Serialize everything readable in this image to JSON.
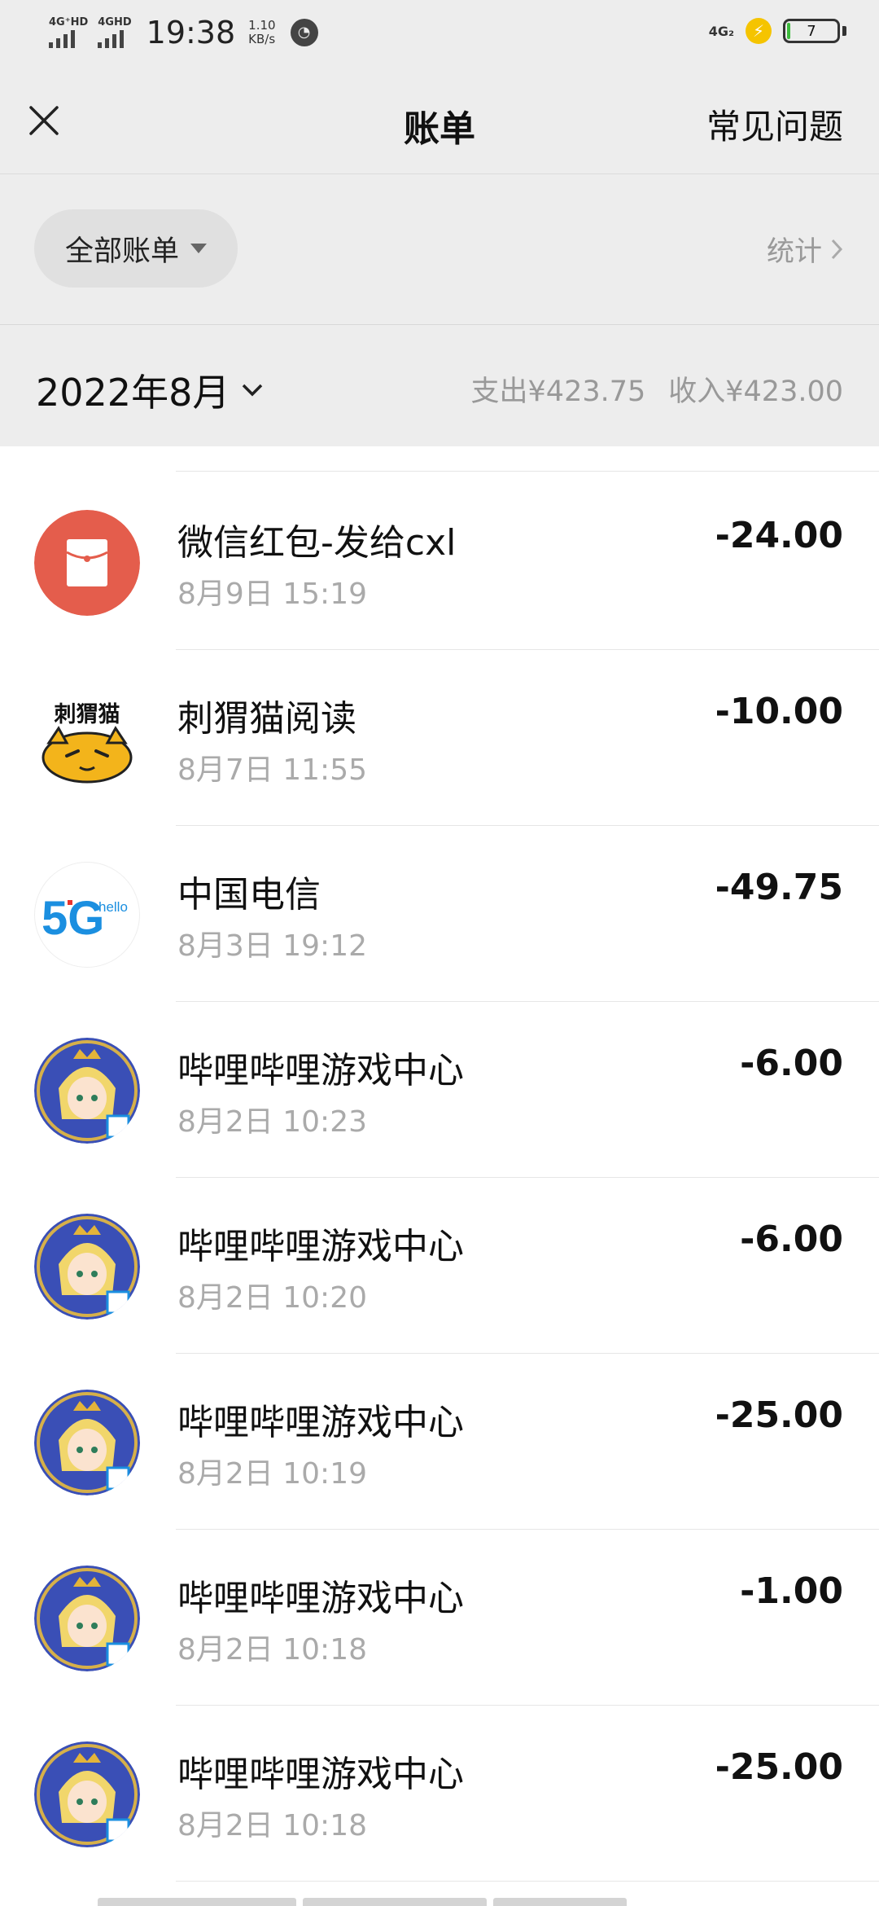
{
  "status_bar": {
    "signal1": "4G⁺HD",
    "signal2": "4GHD",
    "time": "19:38",
    "speed_value": "1.10",
    "speed_unit": "KB/s",
    "network": "4G₂",
    "battery_level": "7",
    "battery_fraction": 0.07
  },
  "nav": {
    "close_icon": "close-icon",
    "title": "账单",
    "faq_label": "常见问题"
  },
  "filter": {
    "label": "全部账单",
    "stats_label": "统计"
  },
  "month": {
    "label": "2022年8月",
    "expense": "支出¥423.75",
    "income": "收入¥423.00"
  },
  "transactions": [
    {
      "merchant": "微信红包-发给cxl",
      "time": "8月9日 15:19",
      "amount": "-24.00",
      "icon": "red-packet-icon"
    },
    {
      "merchant": "刺猬猫阅读",
      "time": "8月7日 11:55",
      "amount": "-10.00",
      "icon": "ciweimao-logo"
    },
    {
      "merchant": "中国电信",
      "time": "8月3日 19:12",
      "amount": "-49.75",
      "icon": "5g-hello-logo"
    },
    {
      "merchant": "哔哩哔哩游戏中心",
      "time": "8月2日 10:23",
      "amount": "-6.00",
      "icon": "game-avatar"
    },
    {
      "merchant": "哔哩哔哩游戏中心",
      "time": "8月2日 10:20",
      "amount": "-6.00",
      "icon": "game-avatar"
    },
    {
      "merchant": "哔哩哔哩游戏中心",
      "time": "8月2日 10:19",
      "amount": "-25.00",
      "icon": "game-avatar"
    },
    {
      "merchant": "哔哩哔哩游戏中心",
      "time": "8月2日 10:18",
      "amount": "-1.00",
      "icon": "game-avatar"
    },
    {
      "merchant": "哔哩哔哩游戏中心",
      "time": "8月2日 10:18",
      "amount": "-25.00",
      "icon": "game-avatar"
    }
  ],
  "logos": {
    "ciweimao_text": "刺猬猫",
    "telecom_5g": "5G",
    "telecom_hello": "hello"
  },
  "colors": {
    "background": "#ededed",
    "list_background": "#ffffff",
    "red_packet": "#e45d4c",
    "secondary_text": "#999999"
  }
}
